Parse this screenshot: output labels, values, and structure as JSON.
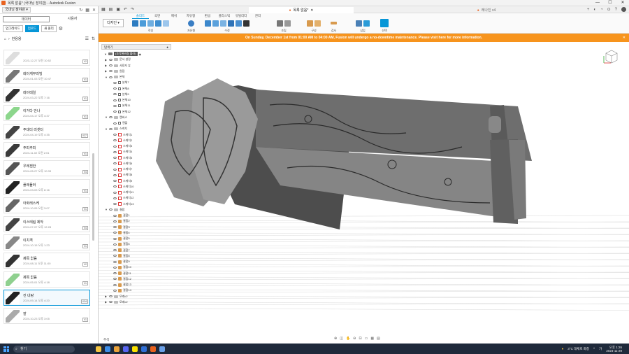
{
  "window": {
    "title": "목록 없음* (국대닝 장야관) - Autodesk Fusion",
    "min": "—",
    "max": "☐",
    "close": "✕"
  },
  "left_panel": {
    "project": "국대닝 장야관",
    "tabs": [
      "데이터",
      "사용자"
    ],
    "buttons": [
      "업그레이드",
      "업로드",
      "새 폴더"
    ],
    "path": "한응용",
    "files": [
      {
        "name": "",
        "date": "2023-12-27 오전 10:52",
        "ver": "V2"
      },
      {
        "name": "레이캐부러빙",
        "date": "2024-01-03 오전 10:47",
        "ver": "V1"
      },
      {
        "name": "레이테일",
        "date": "2024-03-22 오후 7:16",
        "ver": "V1"
      },
      {
        "name": "이거다 안나",
        "date": "2024-04-17 오후 4:37",
        "ver": "V1"
      },
      {
        "name": "주대더 러셋터",
        "date": "2024-04-19 오후 4:35",
        "ver": "V37"
      },
      {
        "name": "주피주피",
        "date": "2024-11-02 오전 2:01",
        "ver": "V1"
      },
      {
        "name": "우레젠한",
        "date": "2024-05-27 오후 10:33",
        "ver": "V4"
      },
      {
        "name": "플레뮬러",
        "date": "2024-03-03 오후 8:16",
        "ver": "V1"
      },
      {
        "name": "아화레스케",
        "date": "2024-10-05 오전 3:07",
        "ver": "V1"
      },
      {
        "name": "이스테림 제작",
        "date": "2024-07-07 오후 12:28",
        "ver": "V4"
      },
      {
        "name": "이치격",
        "date": "2024-10-15 오후 1:23",
        "ver": "V1"
      },
      {
        "name": "제목 없음",
        "date": "2024-08-11 오후 11:00",
        "ver": "V2"
      },
      {
        "name": "제목 없음",
        "date": "2024-05-01 오후 4:18",
        "ver": "V1"
      },
      {
        "name": "진 내량",
        "date": "2024-09-14 오후 4:20",
        "ver": "V24"
      },
      {
        "name": "잘",
        "date": "2024-10-23 오후 3:05",
        "ver": "V1"
      }
    ]
  },
  "doc_tabs": [
    {
      "label": "목록 없음*"
    },
    {
      "label": "레나진 v4"
    }
  ],
  "ribbon": {
    "workspace": "디자인",
    "tabs": [
      "솔리드",
      "곡면",
      "메쉬",
      "자유형",
      "판금",
      "플라스틱",
      "유틸리티",
      "관리"
    ],
    "groups": [
      "작성",
      "자유형",
      "수정",
      "조립",
      "구성",
      "검사",
      "삽입",
      "선택"
    ]
  },
  "banner": {
    "text": "On Sunday, December 1st from 01:00 AM to 04:00 AM, Fusion will undergo a no-downtime maintenance. Please visit here for more information."
  },
  "browser": {
    "title": "탐색기",
    "root": "(조각완비실 블라)",
    "nodes": [
      {
        "label": "문서 설정",
        "type": "folder",
        "indent": 0
      },
      {
        "label": "사용자 뷰",
        "type": "folder",
        "indent": 0
      },
      {
        "label": "원점",
        "type": "folder",
        "indent": 0
      },
      {
        "label": "본체",
        "type": "folder",
        "indent": 0
      },
      {
        "label": "본체7",
        "type": "body",
        "indent": 1
      },
      {
        "label": "본체8",
        "type": "body",
        "indent": 1
      },
      {
        "label": "본체9",
        "type": "body",
        "indent": 1
      },
      {
        "label": "본체10",
        "type": "body",
        "indent": 1
      },
      {
        "label": "본체11",
        "type": "body",
        "indent": 1
      },
      {
        "label": "본체12",
        "type": "body",
        "indent": 1
      },
      {
        "label": "캔버스",
        "type": "folder",
        "indent": 0
      },
      {
        "label": "캔플",
        "type": "body",
        "indent": 1
      },
      {
        "label": "스케치",
        "type": "folder",
        "indent": 0
      },
      {
        "label": "스케치1",
        "type": "sketch",
        "indent": 1
      },
      {
        "label": "스케치2",
        "type": "sketch",
        "indent": 1
      },
      {
        "label": "스케치3",
        "type": "sketch",
        "indent": 1
      },
      {
        "label": "스케치4",
        "type": "sketch",
        "indent": 1
      },
      {
        "label": "스케치5",
        "type": "sketch",
        "indent": 1
      },
      {
        "label": "스케치6",
        "type": "sketch",
        "indent": 1
      },
      {
        "label": "스케치7",
        "type": "sketch",
        "indent": 1
      },
      {
        "label": "스케치8",
        "type": "sketch",
        "indent": 1
      },
      {
        "label": "스케치9",
        "type": "sketch",
        "indent": 1
      },
      {
        "label": "스케치10",
        "type": "sketch",
        "indent": 1
      },
      {
        "label": "스케치11",
        "type": "sketch",
        "indent": 1
      },
      {
        "label": "스케치12",
        "type": "sketch",
        "indent": 1
      },
      {
        "label": "스케치13",
        "type": "sketch",
        "indent": 1
      },
      {
        "label": "결합",
        "type": "folder",
        "indent": 0
      },
      {
        "label": "결합1",
        "type": "joint",
        "indent": 1
      },
      {
        "label": "결합2",
        "type": "joint",
        "indent": 1
      },
      {
        "label": "결합3",
        "type": "joint",
        "indent": 1
      },
      {
        "label": "결합4",
        "type": "joint",
        "indent": 1
      },
      {
        "label": "결합5",
        "type": "joint",
        "indent": 1
      },
      {
        "label": "결합6",
        "type": "joint",
        "indent": 1
      },
      {
        "label": "결합7",
        "type": "joint",
        "indent": 1
      },
      {
        "label": "결합8",
        "type": "joint",
        "indent": 1
      },
      {
        "label": "결합9",
        "type": "joint",
        "indent": 1
      },
      {
        "label": "결합10",
        "type": "joint",
        "indent": 1
      },
      {
        "label": "결합11",
        "type": "joint",
        "indent": 1
      },
      {
        "label": "결합12",
        "type": "joint",
        "indent": 1
      },
      {
        "label": "결합13",
        "type": "joint",
        "indent": 1
      },
      {
        "label": "결합14",
        "type": "joint",
        "indent": 1
      },
      {
        "label": "모래c2",
        "type": "comp",
        "indent": 0
      },
      {
        "label": "모래c2",
        "type": "comp",
        "indent": 0
      }
    ]
  },
  "comments": "주석",
  "taskbar": {
    "search": "찾기",
    "weather": "3°C 대체로 화창",
    "time": "오후 1:26",
    "date": "2024-11-29",
    "lang": "가"
  }
}
